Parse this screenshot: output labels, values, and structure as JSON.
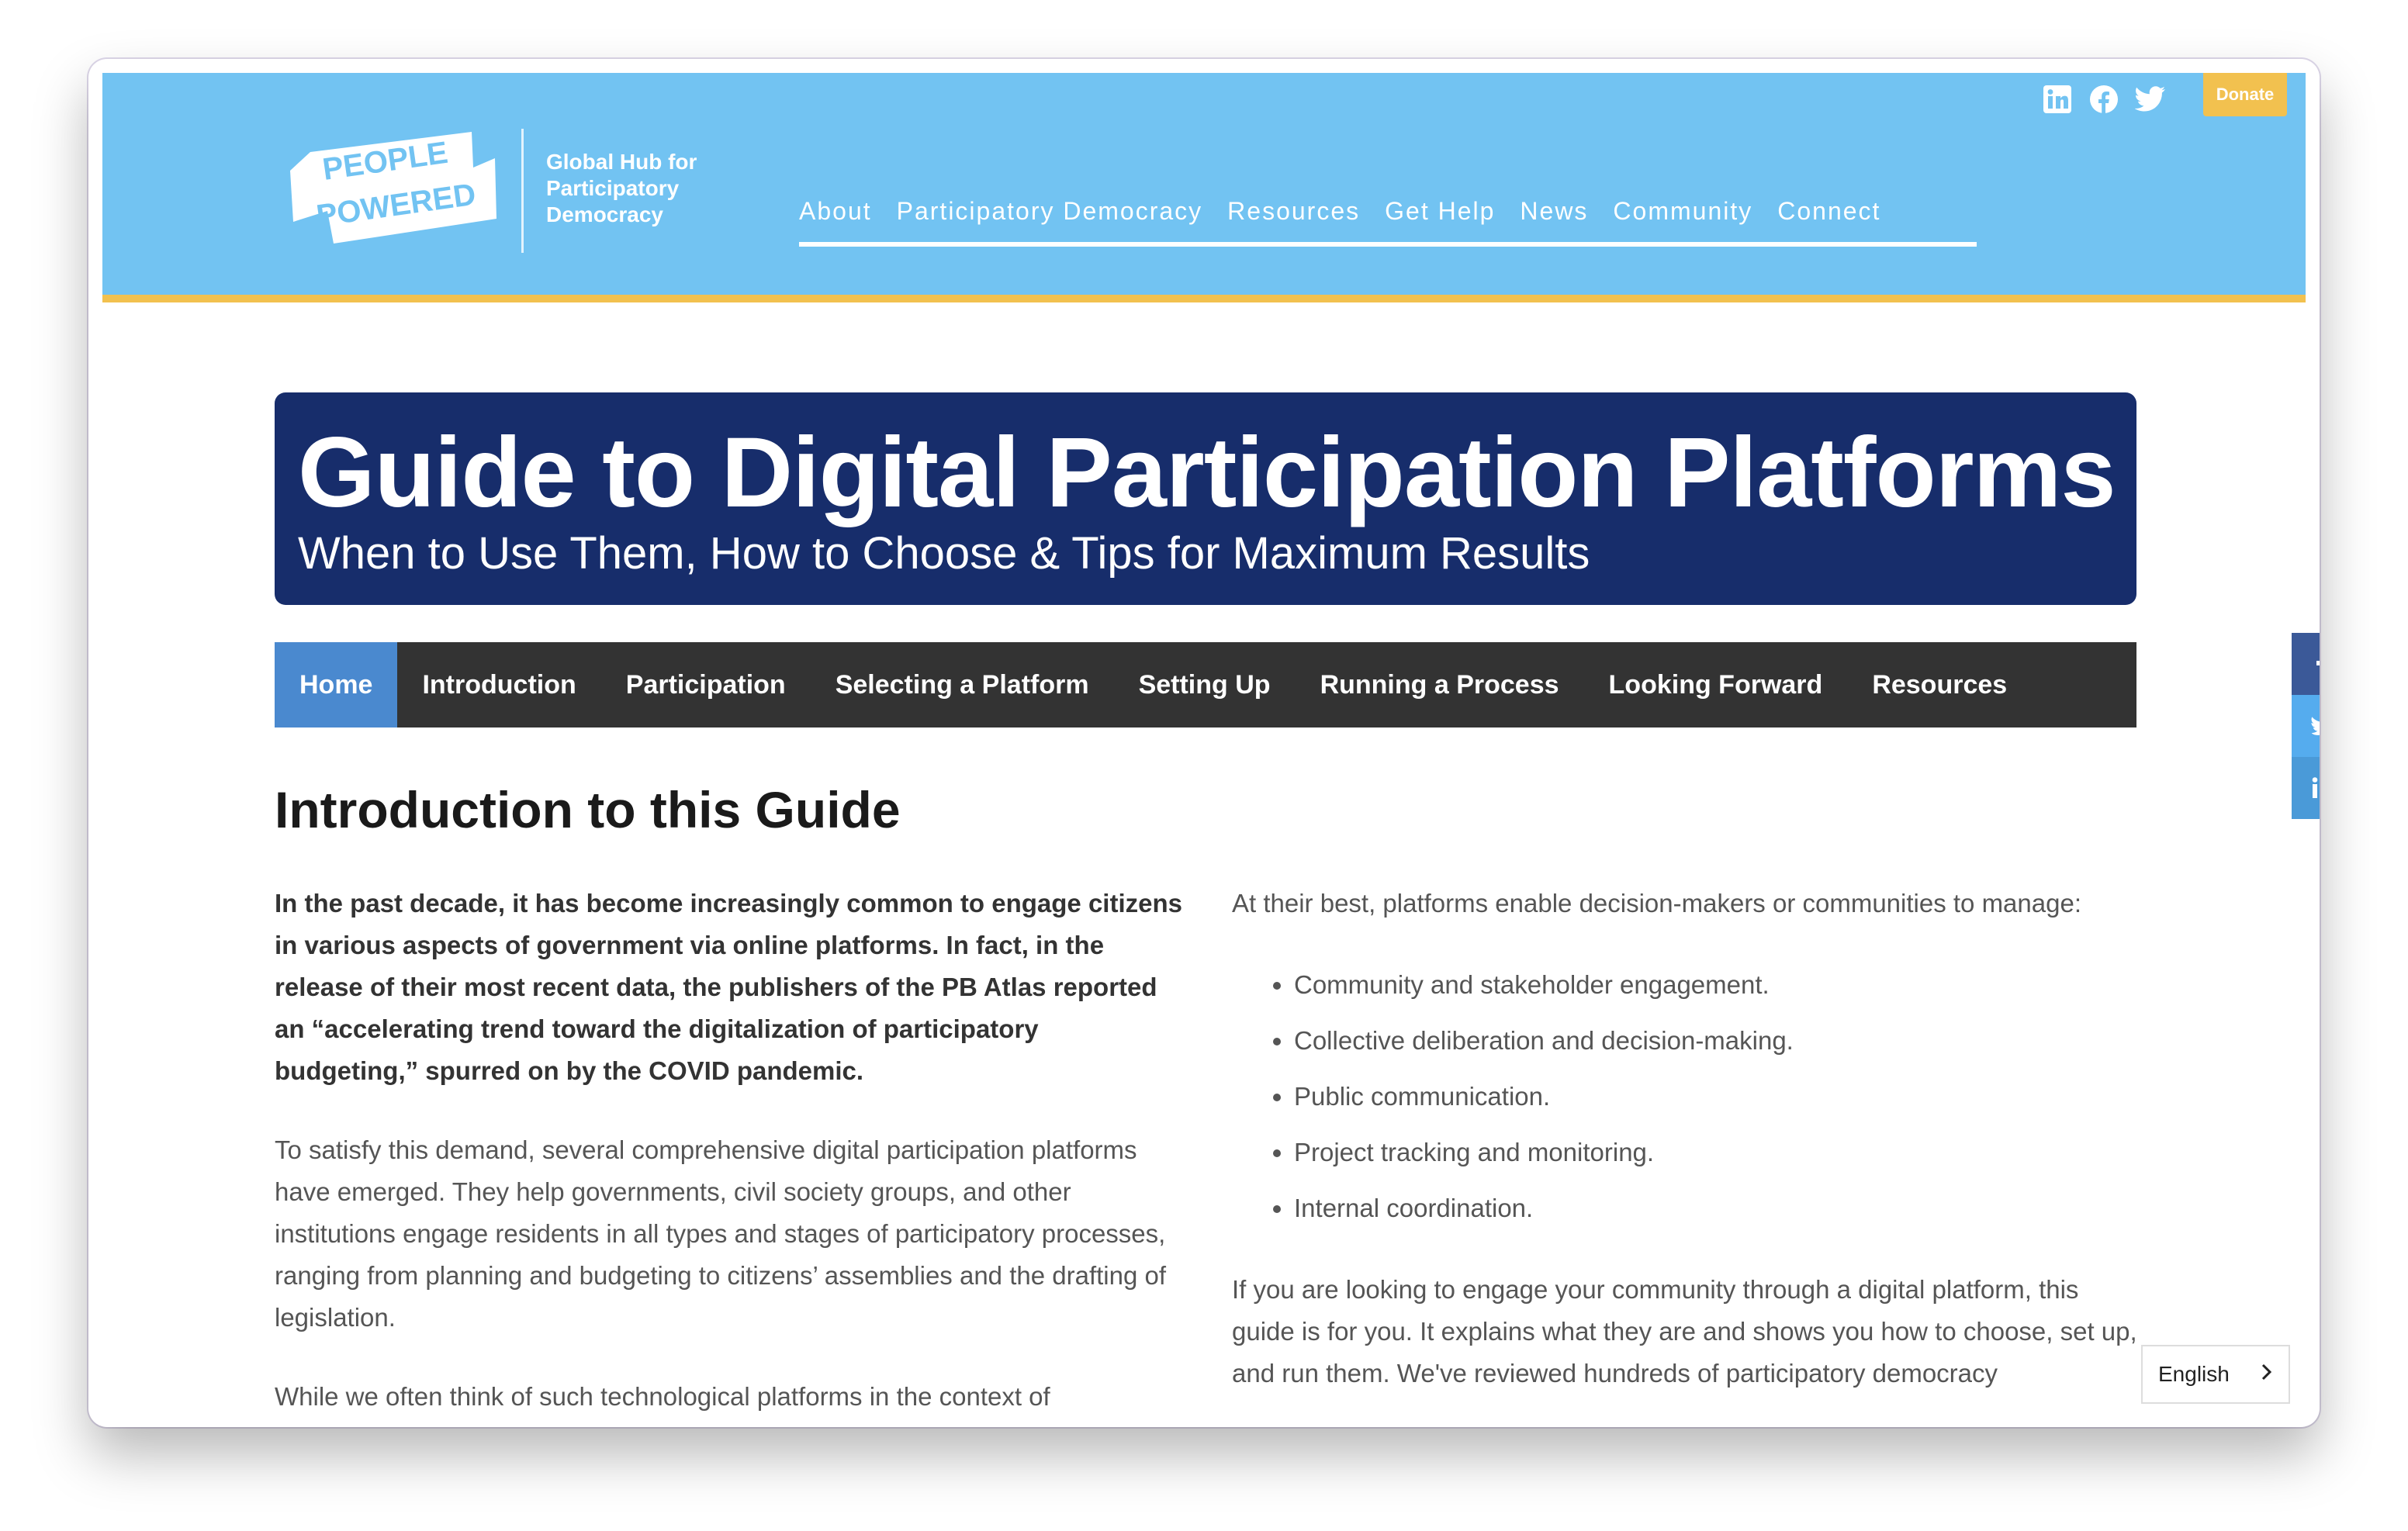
{
  "header": {
    "logo_text_line1": "PEOPLE",
    "logo_text_line2": "POWERED",
    "tagline": [
      "Global Hub for",
      "Participatory",
      "Democracy"
    ],
    "social_icons": [
      "linkedin-icon",
      "facebook-icon",
      "twitter-icon"
    ],
    "donate_label": "Donate",
    "nav": [
      "About",
      "Participatory Democracy",
      "Resources",
      "Get Help",
      "News",
      "Community",
      "Connect"
    ]
  },
  "banner": {
    "title": "Guide to Digital Participation Platforms",
    "subtitle": "When to Use Them, How to Choose & Tips for Maximum Results"
  },
  "guide_nav": {
    "tabs": [
      "Home",
      "Introduction",
      "Participation",
      "Selecting a Platform",
      "Setting Up",
      "Running a Process",
      "Looking Forward",
      "Resources"
    ],
    "active": "Home"
  },
  "content": {
    "heading": "Introduction to this Guide",
    "left": {
      "lead": "In the past decade, it has become increasingly common to engage citizens in various aspects of government via online platforms. In fact, in the release of their most recent data, the publishers of the PB Atlas reported an “accelerating trend toward the digitalization of participatory budgeting,” spurred on by the COVID pandemic.",
      "para2": "To satisfy this demand, several comprehensive digital participation platforms have emerged. They help governments, civil society groups, and other institutions engage residents in all types and stages of participatory processes, ranging from planning and budgeting to citizens’ assemblies and the drafting of legislation.",
      "para3": "While we often think of such technological platforms in the context of"
    },
    "right": {
      "intro": "At their best, platforms enable decision-makers or communities to manage:",
      "bullets": [
        "Community and stakeholder engagement.",
        "Collective deliberation and decision-making.",
        "Public communication.",
        "Project tracking and monitoring.",
        "Internal coordination."
      ],
      "para2": "If you are looking to engage your community through a digital platform, this guide is for you. It explains what they are and shows you how to choose, set up, and run them. We've reviewed hundreds of participatory democracy"
    }
  },
  "share_rail": {
    "icons": [
      "facebook-icon",
      "twitter-icon",
      "linkedin-icon"
    ],
    "colors": [
      "#3b5998",
      "#55acee",
      "#4a9ad8"
    ]
  },
  "language": {
    "selected": "English"
  },
  "colors": {
    "header_bg": "#72c3f2",
    "accent_yellow": "#f2c14f",
    "banner_bg": "#172d6b",
    "guide_nav_bg": "#333333",
    "guide_nav_active": "#4a89cf"
  }
}
